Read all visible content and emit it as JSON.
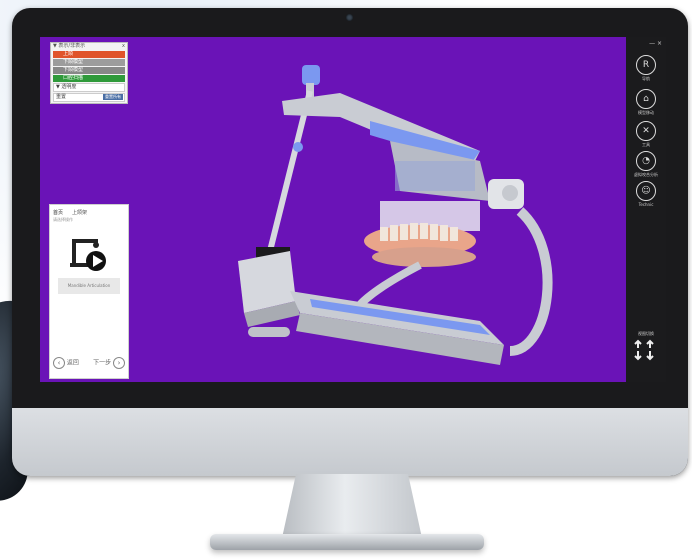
{
  "top_panel": {
    "header": "▼ 表示/非表示",
    "close": "x",
    "layers": [
      {
        "label": "上颌",
        "color": "#e0542b"
      },
      {
        "label": "下颌模型",
        "color": "#9c9c9c"
      },
      {
        "label": "下颌模型",
        "color": "#888888"
      },
      {
        "label": "口腔扫描",
        "color": "#2f9a3a"
      }
    ],
    "opacity_label": "▼ 透明度",
    "reset_label": "重置",
    "reset_button": "重置所有"
  },
  "wizard": {
    "title": "首页",
    "title2": "上颌架",
    "subtitle": "请选择操作",
    "tag": "Mandible Articulation",
    "prev": "返回",
    "next": "下一步"
  },
  "toolbar": {
    "window_controls": "— ×",
    "buttons": [
      {
        "icon": "R",
        "label": "导航"
      },
      {
        "icon": "⌂",
        "label": "模型移动"
      },
      {
        "icon": "✕",
        "label": "工具"
      },
      {
        "icon": "◔",
        "label": "虚拟咬合分析"
      },
      {
        "icon": "☺",
        "label": "Technic"
      }
    ],
    "view_label": "视图切换"
  },
  "colors": {
    "screen_bg": "#6a13b7",
    "accent_blue": "#7b98f0",
    "metal": "#c9ccd3",
    "gum": "#e9a58a",
    "tooth": "#f1e6dc"
  }
}
